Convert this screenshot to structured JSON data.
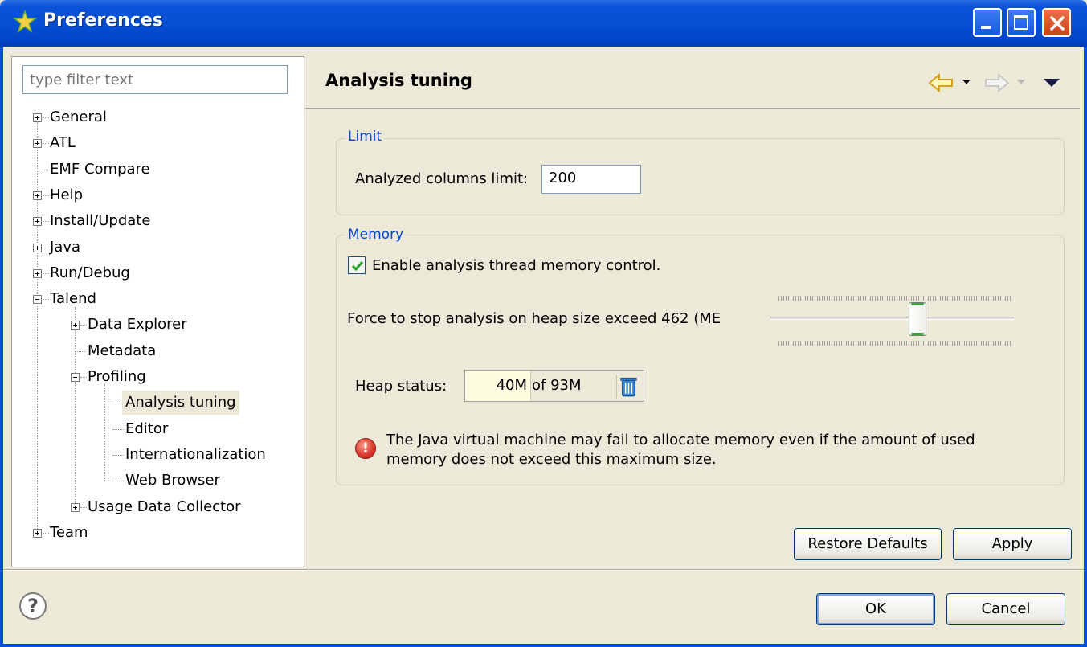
{
  "window": {
    "title": "Preferences",
    "accent_color": "#0550d4",
    "icons": {
      "app": "star-icon",
      "minimize": "minimize-icon",
      "maximize": "maximize-icon",
      "close": "close-icon"
    }
  },
  "sidebar": {
    "filter_placeholder": "type filter text",
    "items": [
      {
        "label": "General",
        "expander": "plus"
      },
      {
        "label": "ATL",
        "expander": "plus"
      },
      {
        "label": "EMF Compare",
        "expander": "none"
      },
      {
        "label": "Help",
        "expander": "plus"
      },
      {
        "label": "Install/Update",
        "expander": "plus"
      },
      {
        "label": "Java",
        "expander": "plus"
      },
      {
        "label": "Run/Debug",
        "expander": "plus"
      },
      {
        "label": "Talend",
        "expander": "minus"
      },
      {
        "label": "Data Explorer",
        "expander": "plus"
      },
      {
        "label": "Metadata",
        "expander": "none"
      },
      {
        "label": "Profiling",
        "expander": "minus"
      },
      {
        "label": "Analysis tuning",
        "expander": "none",
        "selected": true
      },
      {
        "label": "Editor",
        "expander": "none"
      },
      {
        "label": "Internationalization",
        "expander": "none"
      },
      {
        "label": "Web Browser",
        "expander": "none"
      },
      {
        "label": "Usage Data Collector",
        "expander": "plus"
      },
      {
        "label": "Team",
        "expander": "plus"
      }
    ]
  },
  "page": {
    "title": "Analysis tuning",
    "nav_icons": [
      "back-arrow-icon",
      "dropdown-icon",
      "forward-arrow-icon",
      "dropdown-icon",
      "view-menu-icon"
    ],
    "limit_group": {
      "label": "Limit",
      "columns_limit_label": "Analyzed columns limit:",
      "columns_limit_value": "200"
    },
    "memory_group": {
      "label": "Memory",
      "enable_checkbox_label": "Enable analysis thread memory control.",
      "enable_checked": true,
      "force_stop_label": "Force to stop analysis on heap size exceed 462 (ME",
      "slider_level_fraction": 0.61,
      "heap_status_label": "Heap status:",
      "heap_used": "40M",
      "heap_total": "of 93M",
      "warning_text": "The Java virtual machine may fail to allocate memory even if the amount of used memory does not exceed this maximum size."
    },
    "restore_defaults_label": "Restore Defaults",
    "apply_label": "Apply"
  },
  "footer": {
    "help_symbol": "?",
    "ok_label": "OK",
    "cancel_label": "Cancel"
  }
}
